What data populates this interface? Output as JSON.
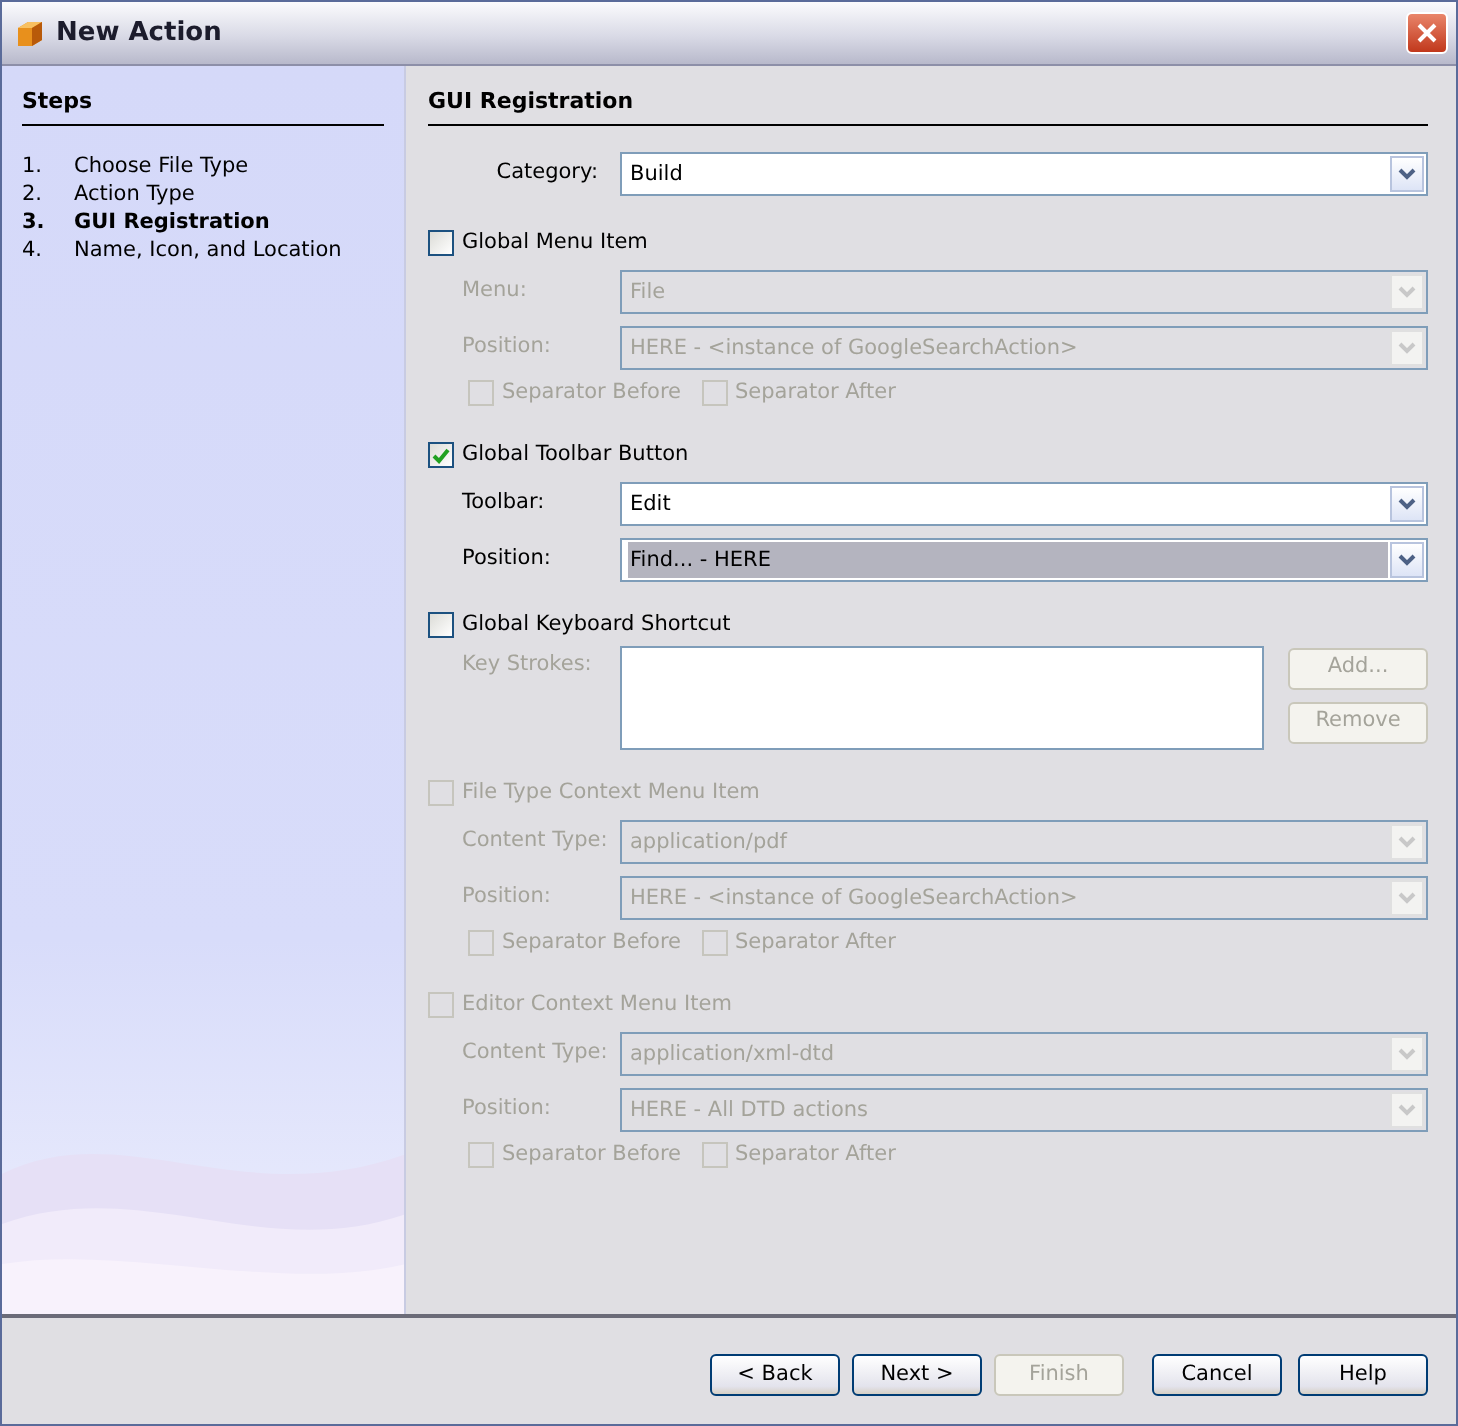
{
  "window": {
    "title": "New Action"
  },
  "steps": {
    "title": "Steps",
    "items": [
      {
        "number": "1.",
        "label": "Choose File Type",
        "selected": false
      },
      {
        "number": "2.",
        "label": "Action Type",
        "selected": false
      },
      {
        "number": "3.",
        "label": "GUI Registration",
        "selected": true
      },
      {
        "number": "4.",
        "label": "Name, Icon, and Location",
        "selected": false
      }
    ]
  },
  "panel": {
    "title": "GUI Registration",
    "category": {
      "label": "Category:",
      "value": "Build"
    },
    "sections": [
      {
        "kind": "combos",
        "label": "Global Menu Item",
        "checked": false,
        "disabled": false,
        "fields": [
          {
            "label": "Menu:",
            "value": "File",
            "disabled": true,
            "highlighted": false
          },
          {
            "label": "Position:",
            "value": "HERE - <instance of GoogleSearchAction>",
            "disabled": true,
            "highlighted": false
          }
        ],
        "separators": [
          {
            "label": "Separator Before",
            "checked": false,
            "disabled": true
          },
          {
            "label": "Separator After",
            "checked": false,
            "disabled": true
          }
        ]
      },
      {
        "kind": "combos",
        "label": "Global Toolbar Button",
        "checked": true,
        "disabled": false,
        "fields": [
          {
            "label": "Toolbar:",
            "value": "Edit",
            "disabled": false,
            "highlighted": false
          },
          {
            "label": "Position:",
            "value": "Find... - HERE",
            "disabled": false,
            "highlighted": true
          }
        ]
      },
      {
        "kind": "keystrokes",
        "label": "Global Keyboard Shortcut",
        "checked": false,
        "disabled": false,
        "field_label": "Key Strokes:",
        "buttons": [
          {
            "label": "Add...",
            "disabled": true
          },
          {
            "label": "Remove",
            "disabled": true
          }
        ]
      },
      {
        "kind": "combos",
        "label": "File Type Context Menu Item",
        "checked": false,
        "disabled": true,
        "fields": [
          {
            "label": "Content Type:",
            "value": "application/pdf",
            "disabled": true,
            "highlighted": false
          },
          {
            "label": "Position:",
            "value": "HERE - <instance of GoogleSearchAction>",
            "disabled": true,
            "highlighted": false
          }
        ],
        "separators": [
          {
            "label": "Separator Before",
            "checked": false,
            "disabled": true
          },
          {
            "label": "Separator After",
            "checked": false,
            "disabled": true
          }
        ]
      },
      {
        "kind": "combos",
        "label": "Editor Context Menu Item",
        "checked": false,
        "disabled": true,
        "fields": [
          {
            "label": "Content Type:",
            "value": "application/xml-dtd",
            "disabled": true,
            "highlighted": false
          },
          {
            "label": "Position:",
            "value": "HERE - All DTD actions",
            "disabled": true,
            "highlighted": false
          }
        ],
        "separators": [
          {
            "label": "Separator Before",
            "checked": false,
            "disabled": true
          },
          {
            "label": "Separator After",
            "checked": false,
            "disabled": true
          }
        ]
      }
    ]
  },
  "buttons": [
    {
      "label": "< Back",
      "disabled": false
    },
    {
      "label": "Next >",
      "disabled": false
    },
    {
      "label": "Finish",
      "disabled": true
    },
    {
      "label": "Cancel",
      "disabled": false
    },
    {
      "label": "Help",
      "disabled": false
    }
  ]
}
